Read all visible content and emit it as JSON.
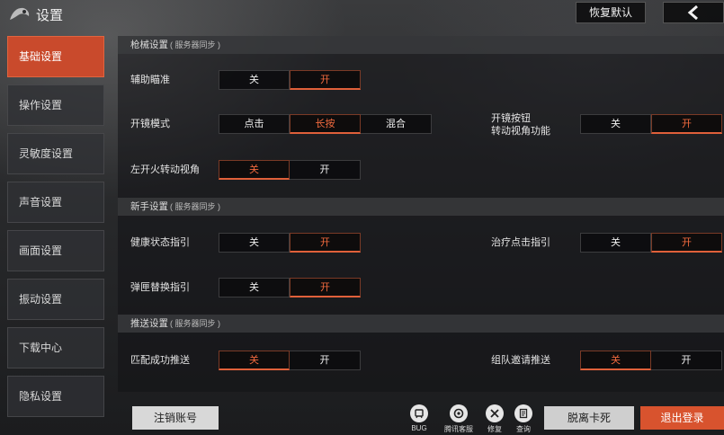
{
  "header": {
    "title": "设置",
    "reset_label": "恢复默认"
  },
  "sidebar": {
    "items": [
      {
        "label": "基础设置",
        "active": true
      },
      {
        "label": "操作设置"
      },
      {
        "label": "灵敏度设置"
      },
      {
        "label": "声音设置"
      },
      {
        "label": "画面设置"
      },
      {
        "label": "振动设置"
      },
      {
        "label": "下载中心"
      },
      {
        "label": "隐私设置"
      }
    ]
  },
  "sections": {
    "gun": {
      "title": "枪械设置",
      "note": "( 服务器同步 )",
      "aim_assist": {
        "label": "辅助瞄准",
        "options": [
          "关",
          "开"
        ],
        "selected": "开"
      },
      "scope_mode": {
        "label": "开镜模式",
        "options": [
          "点击",
          "长按",
          "混合"
        ],
        "selected": "长按"
      },
      "scope_button_rotate": {
        "label_line1": "开镜按钮",
        "label_line2": "转动视角功能",
        "options": [
          "关",
          "开"
        ],
        "selected": "开"
      },
      "left_fire_rotate": {
        "label": "左开火转动视角",
        "options": [
          "关",
          "开"
        ],
        "selected": "关"
      }
    },
    "newbie": {
      "title": "新手设置",
      "note": "( 服务器同步 )",
      "health_guide": {
        "label": "健康状态指引",
        "options": [
          "关",
          "开"
        ],
        "selected": "开"
      },
      "heal_click_guide": {
        "label": "治疗点击指引",
        "options": [
          "关",
          "开"
        ],
        "selected": "开"
      },
      "mag_swap_guide": {
        "label": "弹匣替换指引",
        "options": [
          "关",
          "开"
        ],
        "selected": "开"
      }
    },
    "push": {
      "title": "推送设置",
      "note": "( 服务器同步 )",
      "match_success": {
        "label": "匹配成功推送",
        "options": [
          "关",
          "开"
        ],
        "selected": "关"
      },
      "team_invite": {
        "label": "组队邀请推送",
        "options": [
          "关",
          "开"
        ],
        "selected": "关"
      }
    }
  },
  "footer": {
    "cancel_account_label": "注销账号",
    "tools": [
      {
        "icon": "bug-icon",
        "label": "BUG"
      },
      {
        "icon": "support-icon",
        "label": "腾讯客服"
      },
      {
        "icon": "repair-icon",
        "label": "修复"
      },
      {
        "icon": "query-icon",
        "label": "查询"
      }
    ],
    "unstuck_label": "脱离卡死",
    "exit_label": "退出登录"
  },
  "colors": {
    "accent": "#d8532e",
    "active_text": "#f26a3e"
  }
}
